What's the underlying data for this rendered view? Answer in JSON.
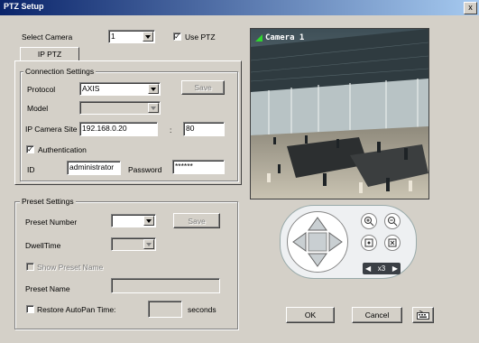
{
  "window": {
    "title": "PTZ Setup",
    "close": "x"
  },
  "camera": {
    "select_label": "Select Camera",
    "selected": "1",
    "use_ptz_label": "Use PTZ",
    "use_ptz_checked": true
  },
  "tab": {
    "label": "IP PTZ"
  },
  "connection": {
    "group_label": "Connection Settings",
    "protocol_label": "Protocol",
    "protocol_value": "AXIS",
    "save_label": "Save",
    "model_label": "Model",
    "model_value": "",
    "site_label": "IP Camera Site",
    "site_value": "192.168.0.20",
    "colon": ":",
    "port_value": "80",
    "auth_label": "Authentication",
    "auth_checked": true,
    "id_label": "ID",
    "id_value": "administrator",
    "password_label": "Password",
    "password_value": "******"
  },
  "preset": {
    "group_label": "Preset Settings",
    "number_label": "Preset Number",
    "number_value": "",
    "save_label": "Save",
    "dwell_label": "DwellTime",
    "dwell_value": "",
    "show_name_label": "Show Preset Name",
    "name_label": "Preset Name",
    "name_value": "",
    "autopan_label": "Restore AutoPan Time:",
    "autopan_value": "",
    "seconds_label": "seconds"
  },
  "video": {
    "camera_label": "Camera 1"
  },
  "ptz": {
    "speed_label": "x3"
  },
  "footer": {
    "ok_label": "OK",
    "cancel_label": "Cancel"
  }
}
